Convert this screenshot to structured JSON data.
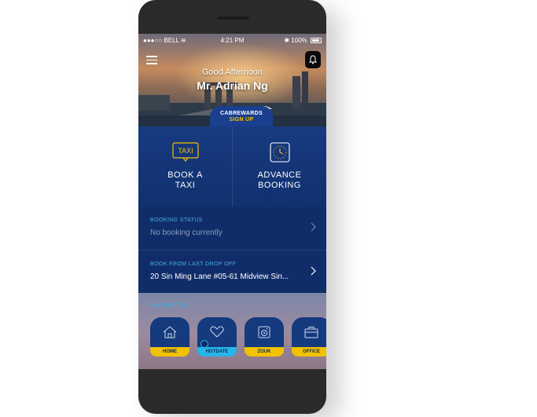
{
  "status_bar": {
    "carrier": "BELL",
    "time": "4:21 PM",
    "battery": "100%"
  },
  "header": {
    "greeting": "Good Afternoon",
    "username": "Mr. Adrian Ng"
  },
  "cabrewards": {
    "title": "CABREWARDS",
    "action": "SIGN UP"
  },
  "actions": [
    {
      "icon_text": "TAXI",
      "label_line1": "BOOK A",
      "label_line2": "TAXI"
    },
    {
      "label_line1": "ADVANCE",
      "label_line2": "BOOKING"
    }
  ],
  "booking_status": {
    "label": "BOOKING STATUS",
    "value": "No booking currently"
  },
  "last_drop_off": {
    "label": "BOOK FROM LAST DROP OFF",
    "value": "20 Sin Ming Lane #05-61 Midview Sin..."
  },
  "favourites": {
    "label": "FAVOURITES",
    "items": [
      {
        "name": "HOME",
        "band_color": "#f2c200"
      },
      {
        "name": "HOTDATE",
        "band_color": "#27b6ea"
      },
      {
        "name": "ZOUK",
        "band_color": "#f2c200"
      },
      {
        "name": "OFFICE",
        "band_color": "#f2c200"
      }
    ]
  },
  "colors": {
    "primary_blue": "#10285e",
    "accent_yellow": "#f2c200",
    "accent_cyan": "#45b0e6"
  }
}
